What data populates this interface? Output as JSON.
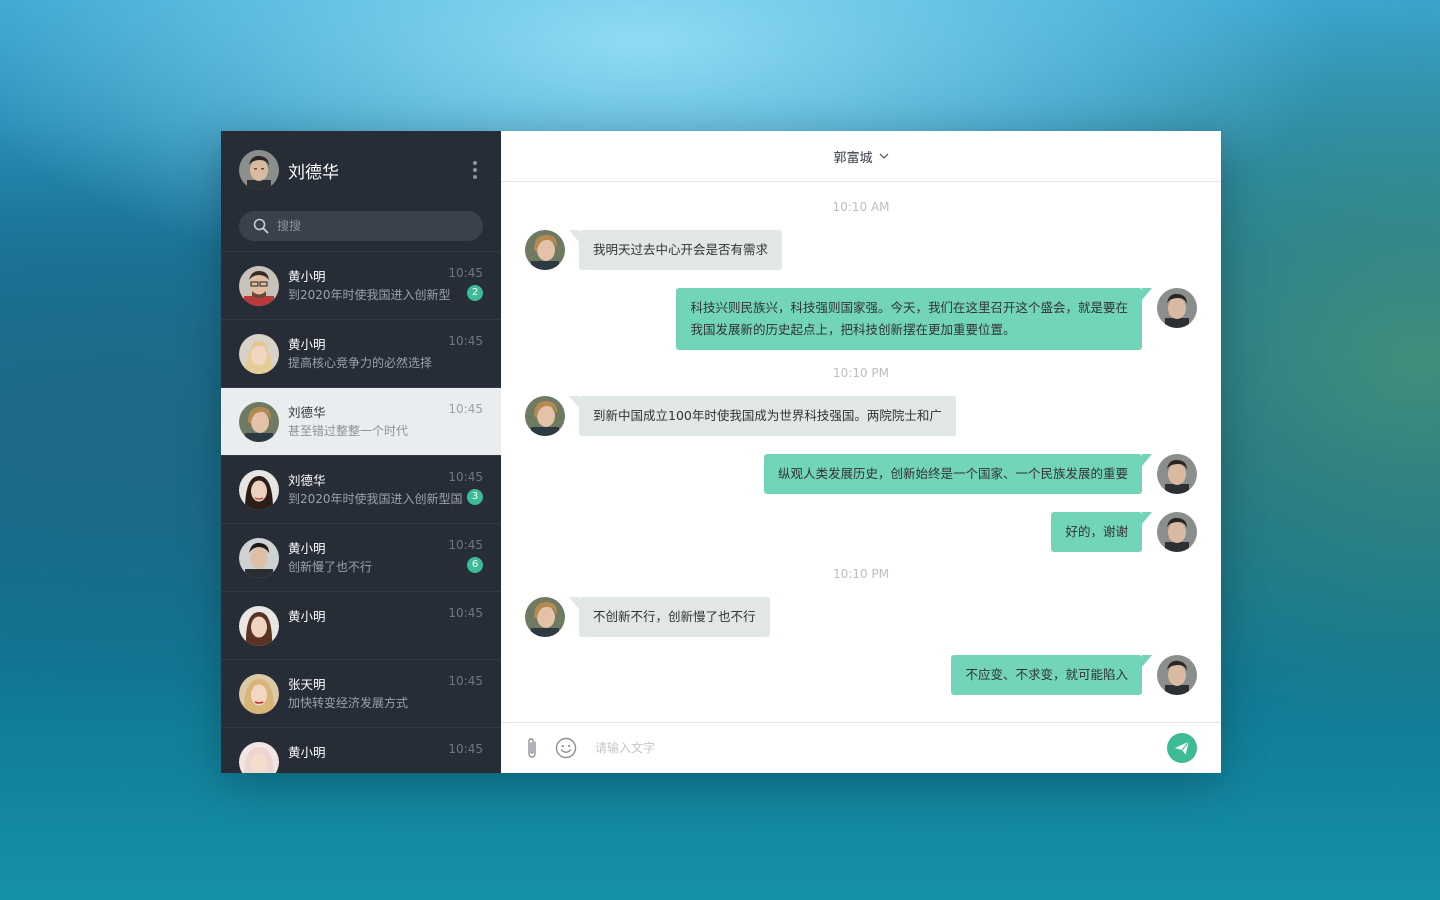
{
  "me": {
    "name": "刘德华"
  },
  "search": {
    "placeholder": "搜搜"
  },
  "contacts": [
    {
      "name": "黄小明",
      "message": "到2020年时使我国进入创新型",
      "time": "10:45",
      "badge": "2"
    },
    {
      "name": "黄小明",
      "message": "提高核心竞争力的必然选择",
      "time": "10:45",
      "badge": ""
    },
    {
      "name": "刘德华",
      "message": "甚至错过整整一个时代",
      "time": "10:45",
      "badge": ""
    },
    {
      "name": "刘德华",
      "message": "到2020年时使我国进入创新型国",
      "time": "10:45",
      "badge": "3"
    },
    {
      "name": "黄小明",
      "message": "创新慢了也不行",
      "time": "10:45",
      "badge": "6"
    },
    {
      "name": "黄小明",
      "message": "",
      "time": "10:45",
      "badge": ""
    },
    {
      "name": "张天明",
      "message": "加快转变经济发展方式",
      "time": "10:45",
      "badge": ""
    },
    {
      "name": "黄小明",
      "message": "",
      "time": "10:45",
      "badge": ""
    }
  ],
  "chat": {
    "title": "郭富城",
    "timestamps": [
      "10:10 AM",
      "10:10 PM",
      "10:10 PM"
    ],
    "messages": [
      {
        "text": "我明天过去中心开会是否有需求"
      },
      {
        "line1": "科技兴则民族兴，科技强则国家强。今天，我们在这里召开这个盛会，就是要在",
        "line2": "我国发展新的历史起点上，把科技创新摆在更加重要位置。"
      },
      {
        "text": "到新中国成立100年时使我国成为世界科技强国。两院院士和广"
      },
      {
        "text": "纵观人类发展历史，创新始终是一个国家、一个民族发展的重要"
      },
      {
        "text": "好的，谢谢"
      },
      {
        "text": "不创新不行，创新慢了也不行"
      },
      {
        "text": "不应变、不求变，就可能陷入"
      }
    ],
    "input_placeholder": "请输入文字"
  },
  "colors": {
    "sidebar": "#262d36",
    "accent": "#3dbb96",
    "outgoing_bubble": "#72d5b9",
    "incoming_bubble": "#e1e7e5"
  },
  "icons": [
    "kebab-menu-icon",
    "search-icon",
    "chevron-down-icon",
    "paperclip-icon",
    "emoji-icon",
    "send-icon"
  ]
}
